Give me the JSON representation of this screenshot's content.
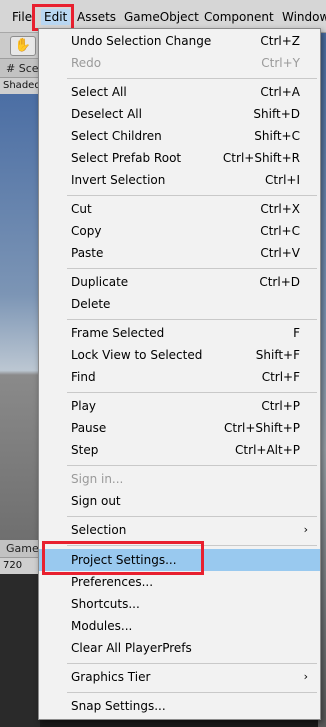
{
  "menubar": {
    "file": "File",
    "edit": "Edit",
    "assets": "Assets",
    "gameobject": "GameObject",
    "component": "Component",
    "window": "Window"
  },
  "background": {
    "scene_tab": "# Scene",
    "scene_sub": "Shaded",
    "game_tab": "Game",
    "game_sub": "720"
  },
  "menu": {
    "undo": {
      "label": "Undo Selection Change",
      "shortcut": "Ctrl+Z"
    },
    "redo": {
      "label": "Redo",
      "shortcut": "Ctrl+Y"
    },
    "select_all": {
      "label": "Select All",
      "shortcut": "Ctrl+A"
    },
    "deselect_all": {
      "label": "Deselect All",
      "shortcut": "Shift+D"
    },
    "select_children": {
      "label": "Select Children",
      "shortcut": "Shift+C"
    },
    "select_prefab": {
      "label": "Select Prefab Root",
      "shortcut": "Ctrl+Shift+R"
    },
    "invert": {
      "label": "Invert Selection",
      "shortcut": "Ctrl+I"
    },
    "cut": {
      "label": "Cut",
      "shortcut": "Ctrl+X"
    },
    "copy": {
      "label": "Copy",
      "shortcut": "Ctrl+C"
    },
    "paste": {
      "label": "Paste",
      "shortcut": "Ctrl+V"
    },
    "duplicate": {
      "label": "Duplicate",
      "shortcut": "Ctrl+D"
    },
    "delete": {
      "label": "Delete",
      "shortcut": ""
    },
    "frame": {
      "label": "Frame Selected",
      "shortcut": "F"
    },
    "lock_view": {
      "label": "Lock View to Selected",
      "shortcut": "Shift+F"
    },
    "find": {
      "label": "Find",
      "shortcut": "Ctrl+F"
    },
    "play": {
      "label": "Play",
      "shortcut": "Ctrl+P"
    },
    "pause": {
      "label": "Pause",
      "shortcut": "Ctrl+Shift+P"
    },
    "step": {
      "label": "Step",
      "shortcut": "Ctrl+Alt+P"
    },
    "sign_in": {
      "label": "Sign in...",
      "shortcut": ""
    },
    "sign_out": {
      "label": "Sign out",
      "shortcut": ""
    },
    "selection": {
      "label": "Selection",
      "arrow": "›"
    },
    "project_settings": {
      "label": "Project Settings...",
      "shortcut": ""
    },
    "preferences": {
      "label": "Preferences...",
      "shortcut": ""
    },
    "shortcuts": {
      "label": "Shortcuts...",
      "shortcut": ""
    },
    "modules": {
      "label": "Modules...",
      "shortcut": ""
    },
    "clear_prefs": {
      "label": "Clear All PlayerPrefs",
      "shortcut": ""
    },
    "graphics_tier": {
      "label": "Graphics Tier",
      "arrow": "›"
    },
    "snap_settings": {
      "label": "Snap Settings...",
      "shortcut": ""
    }
  },
  "colors": {
    "highlight_box": "#e8202f",
    "selected_row": "#99c9ef",
    "active_menu": "#b9d7f2"
  }
}
